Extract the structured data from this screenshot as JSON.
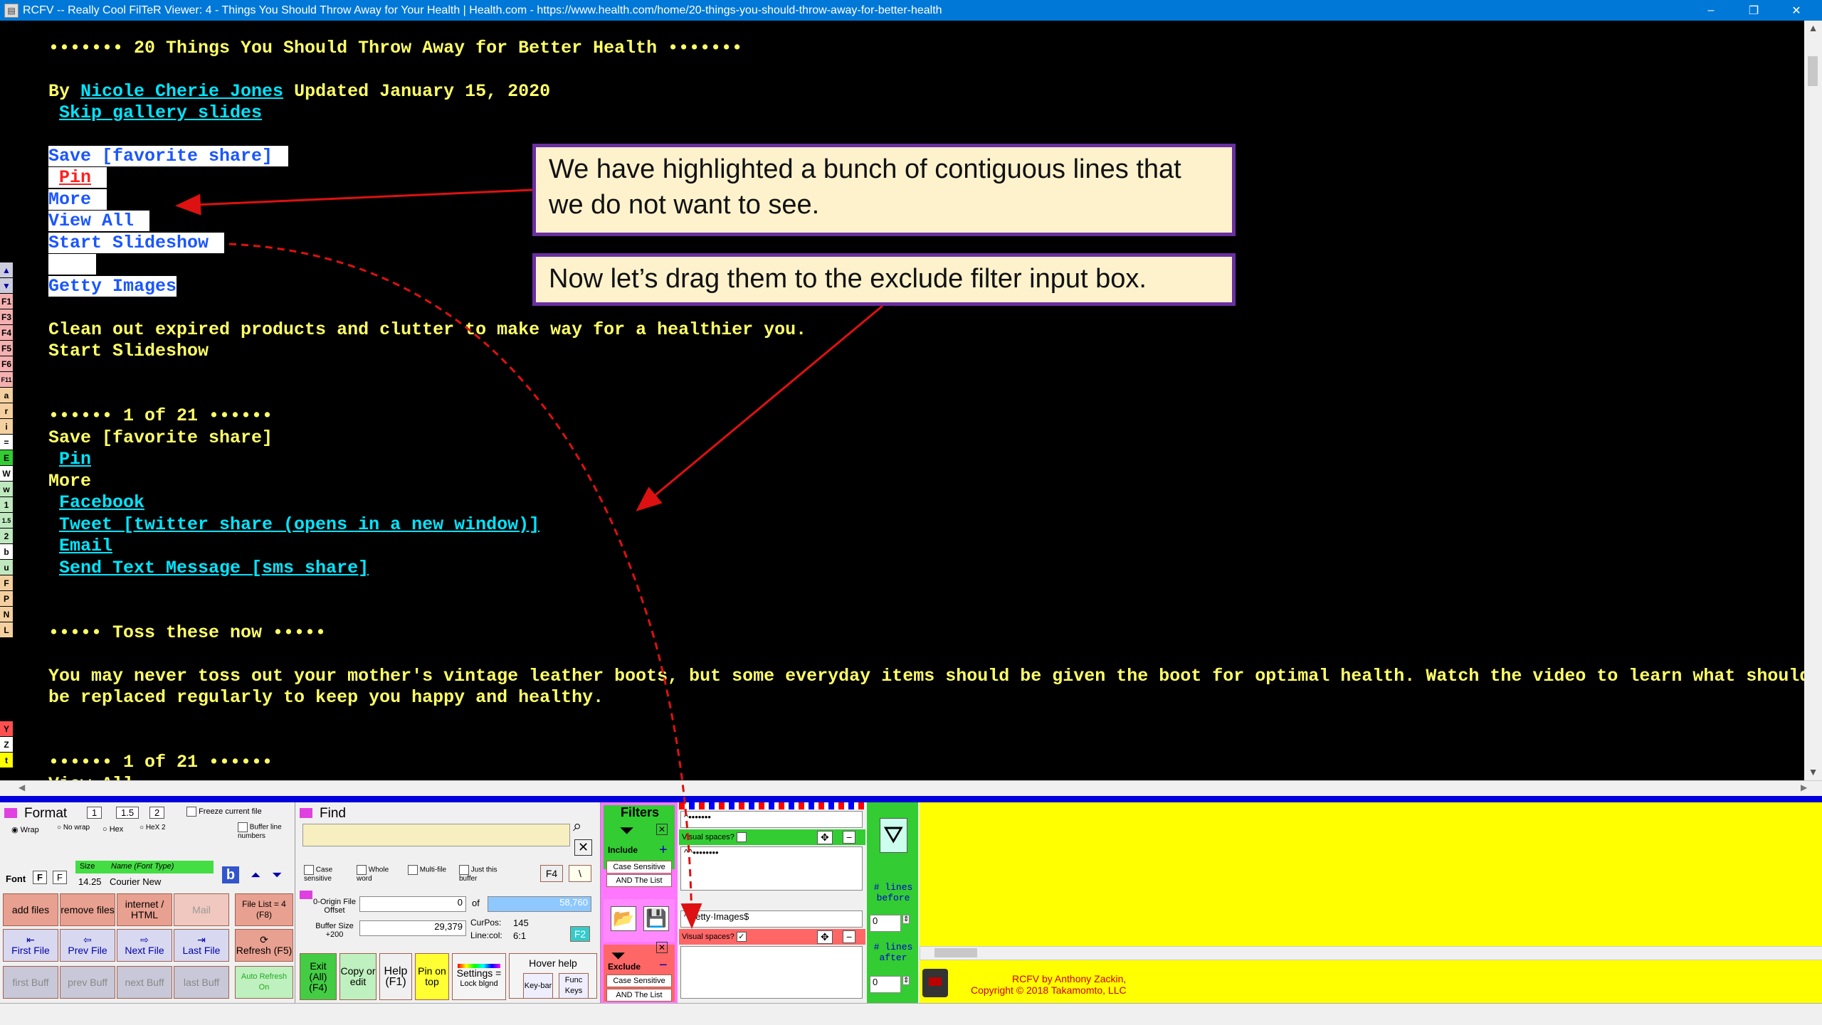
{
  "window": {
    "title": "RCFV -- Really Cool FilTeR Viewer: 4 - Things You Should Throw Away for Your Health | Health.com - https://www.health.com/home/20-things-you-should-throw-away-for-better-health",
    "minimize": "–",
    "restore": "❐",
    "close": "✕"
  },
  "content": {
    "heading": "••••••• 20 Things You Should Throw Away for Better Health •••••••",
    "by_prefix": "By ",
    "author": "Nicole Cherie Jones",
    "updated": " Updated January 15, 2020",
    "skip_gallery": "Skip gallery slides",
    "highlighted": {
      "save": "Save [favorite share]",
      "pin": "Pin",
      "more": "More",
      "view_all": "View All",
      "start_slideshow": "Start Slideshow",
      "getty": "Getty Images"
    },
    "clean_out": "Clean out expired products and clutter to make way for a healthier you.",
    "start_slideshow_2": "Start Slideshow",
    "one_of_21": "•••••• 1 of 21 ••••••",
    "save_2": "Save [favorite share]",
    "pin_2": "Pin",
    "more_2": "More",
    "facebook": "Facebook",
    "tweet": "Tweet [twitter share (opens in a new window)]",
    "email": "Email",
    "sms": "Send Text Message [sms share]",
    "toss_heading": "••••• Toss these now •••••",
    "para_line1": "You may never toss out your mother's vintage leather boots, but some everyday items should be given the boot for optimal health. Watch the video to learn what should",
    "para_line2": "be replaced regularly to keep you happy and healthy.",
    "one_of_21_b": "•••••• 1 of 21 ••••••",
    "partial_next": "View All"
  },
  "left_strip": [
    "▲",
    "▼",
    "F1",
    "F3",
    "F4",
    "F5",
    "F6",
    "F11",
    "a",
    "r",
    "i",
    "=",
    "E",
    "W",
    "w",
    "1",
    "1.5",
    "2",
    "b",
    "u",
    "F",
    "P",
    "N",
    "L"
  ],
  "left_strip_lower": [
    "Y",
    "Z",
    "t"
  ],
  "callouts": {
    "first": "We have highlighted a bunch of contiguous lines that we do not want to see.",
    "second": "Now let’s drag them to the exclude filter input box."
  },
  "format_panel": {
    "title": "Format",
    "line_opts": [
      "1",
      "1.5",
      "2"
    ],
    "freeze": "Freeze current file",
    "wrap": "Wrap",
    "no_wrap": "No wrap",
    "hex": "Hex",
    "hex2": "HeX 2",
    "buffer_line_numbers": "Buffer line numbers",
    "font_label": "Font",
    "size_label": "Size",
    "size_value": "14.25",
    "font_type_label": "Name (Font Type)",
    "font_name": "Courier New",
    "buttons": {
      "add_files": "add files",
      "remove_files": "remove files",
      "internet": "internet / HTML",
      "mail": "Mail",
      "file_list": "File List = 4 (F8)",
      "first_file": "First File",
      "prev_file": "Prev File",
      "next_file": "Next File",
      "last_file": "Last File",
      "refresh": "Refresh (F5)",
      "first_buff": "first Buff",
      "prev_buff": "prev Buff",
      "next_buff": "next Buff",
      "last_buff": "last Buff",
      "auto_refresh": "Auto Refresh On"
    }
  },
  "find_panel": {
    "title": "Find",
    "case_sensitive": "Case sensitive",
    "whole_word": "Whole word",
    "multi_file": "Multi-file",
    "just_buffer": "Just this buffer",
    "f4": "F4",
    "origin_label": "0-Origin File Offset",
    "origin_value": "0",
    "of_label": "of",
    "of_value": "58,760",
    "buffer_label": "Buffer Size +200",
    "buffer_value": "29,379",
    "curpos_label": "CurPos:",
    "curpos_value": "145",
    "linecol_label": "Line:col:",
    "linecol_value": "6:1",
    "f2": "F2",
    "exit": "Exit (All) (F4)",
    "copy_edit": "Copy or edit",
    "help": "Help (F1)",
    "pin_top": "Pin on top",
    "settings": "Settings =",
    "lock": "Lock blgnd",
    "hover_help": "Hover help",
    "keybar": "Key-bar",
    "func_keys": "Func Keys"
  },
  "filters_panel": {
    "title": "Filters",
    "include": "Include",
    "exclude": "Exclude",
    "case_sensitive": "Case Sensitive",
    "and_list": "AND The List",
    "include_input": "^•••••••",
    "include_list_item": "^^••••••••",
    "visual_spaces": "Visual spaces?",
    "exclude_input": "^Getty·Images$",
    "lines_before": "# lines before",
    "lines_after": "# lines after",
    "before_value": "0",
    "after_value": "0"
  },
  "credits": {
    "line1": "RCFV by Anthony Zackin,",
    "line2": "Copyright © 2018 Takamomto, LLC"
  },
  "colors": {
    "titlebar": "#0078d7",
    "text": "#ffff66",
    "link": "#00e5ff",
    "callout_border": "#6a2fa0",
    "callout_bg": "#fdf2cc",
    "arrow": "#dd1111",
    "yellow_panel": "#ffff00"
  }
}
